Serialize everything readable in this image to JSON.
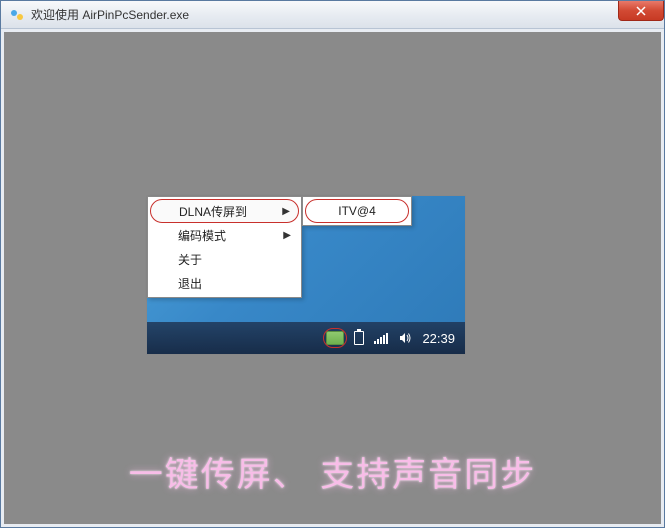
{
  "window": {
    "title": "欢迎使用 AirPinPcSender.exe",
    "close_label": "×"
  },
  "context_menu": {
    "items": [
      {
        "label": "DLNA传屏到",
        "has_submenu": true,
        "highlighted": true
      },
      {
        "label": "编码模式",
        "has_submenu": true,
        "highlighted": false
      },
      {
        "label": "关于",
        "has_submenu": false,
        "highlighted": false
      },
      {
        "label": "退出",
        "has_submenu": false,
        "highlighted": false
      }
    ]
  },
  "submenu": {
    "items": [
      {
        "label": "ITV@4",
        "highlighted": true
      }
    ]
  },
  "taskbar": {
    "clock": "22:39"
  },
  "tagline": "一键传屏、 支持声音同步"
}
